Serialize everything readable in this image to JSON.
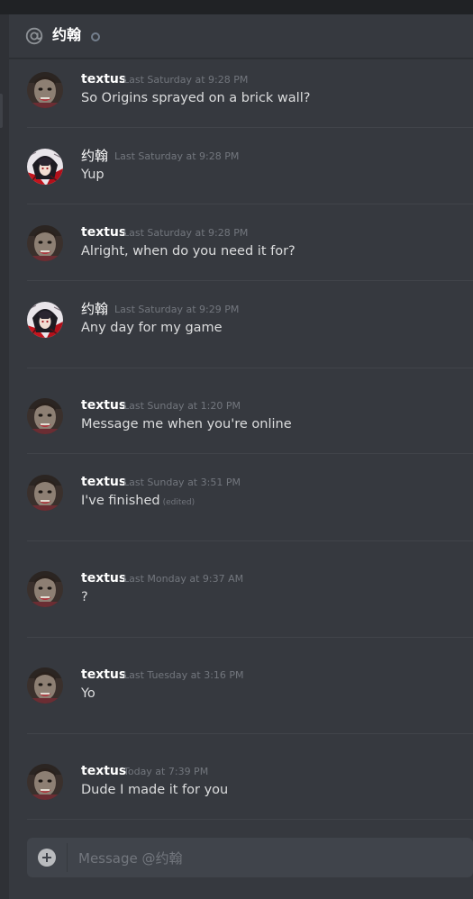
{
  "header": {
    "title": "约翰",
    "status": "offline"
  },
  "composer": {
    "placeholder": "Message @约翰"
  },
  "messages": [
    {
      "author": "textus",
      "timestamp": "Last Saturday at 9:28 PM",
      "text": "So Origins sprayed on a brick wall?",
      "edited": "",
      "avatar": "textus"
    },
    {
      "author": "约翰",
      "timestamp": "Last Saturday at 9:28 PM",
      "text": "Yup",
      "edited": "",
      "avatar": "john"
    },
    {
      "author": "textus",
      "timestamp": "Last Saturday at 9:28 PM",
      "text": "Alright, when do you need it for?",
      "edited": "",
      "avatar": "textus"
    },
    {
      "author": "约翰",
      "timestamp": "Last Saturday at 9:29 PM",
      "text": "Any day for my game",
      "edited": "",
      "avatar": "john"
    },
    {
      "author": "textus",
      "timestamp": "Last Sunday at 1:20 PM",
      "text": "Message me when you're online",
      "edited": "",
      "avatar": "textus"
    },
    {
      "author": "textus",
      "timestamp": "Last Sunday at 3:51 PM",
      "text": "I've finished",
      "edited": "(edited)",
      "avatar": "textus"
    },
    {
      "author": "textus",
      "timestamp": "Last Monday at 9:37 AM",
      "text": "?",
      "edited": "",
      "avatar": "textus"
    },
    {
      "author": "textus",
      "timestamp": "Last Tuesday at 3:16 PM",
      "text": "Yo",
      "edited": "",
      "avatar": "textus"
    },
    {
      "author": "textus",
      "timestamp": "Today at 7:39 PM",
      "text": "Dude I made it for you",
      "edited": "",
      "avatar": "textus"
    }
  ],
  "colors": {
    "background": "#36393f",
    "header_text": "#ffffff",
    "message_text": "#dcddde",
    "timestamp": "#72767d",
    "composer_bg": "#40444b"
  },
  "icons": {
    "header": "at-sign-icon",
    "status": "offline-status-icon",
    "composer_add": "add-attachment-icon"
  }
}
